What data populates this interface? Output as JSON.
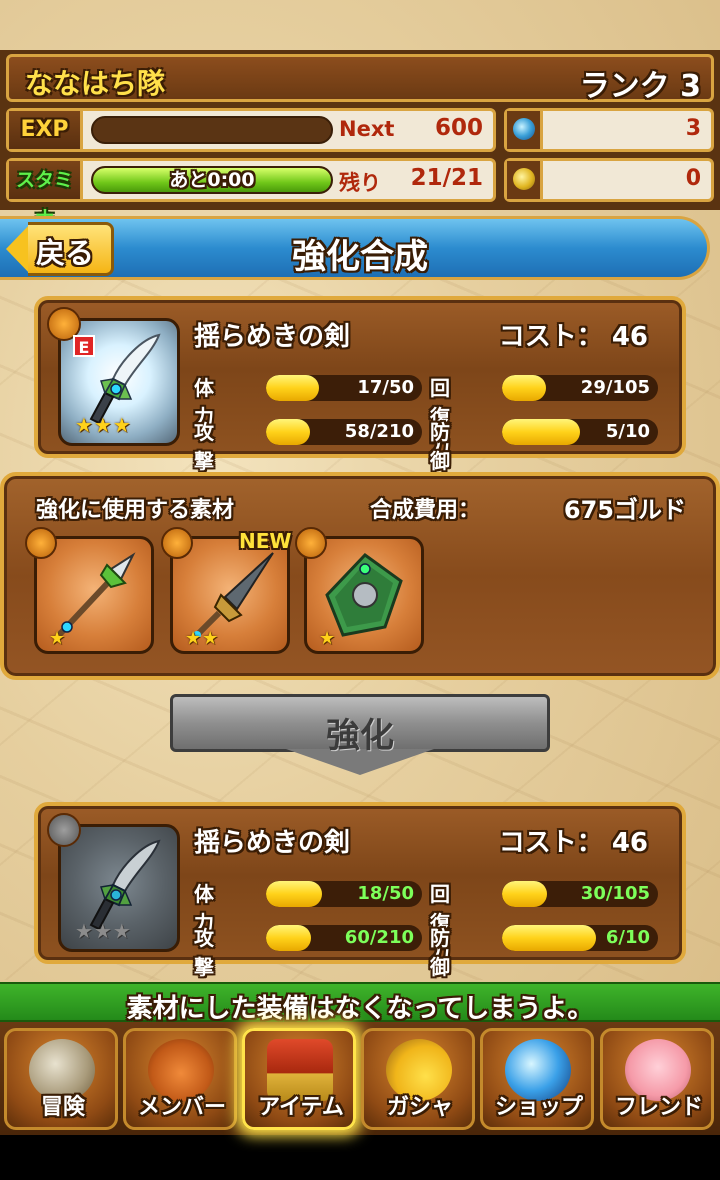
{
  "header": {
    "team_name": "ななはち隊",
    "rank": "ランク 3",
    "exp": {
      "label": "EXP",
      "next_label": "Next",
      "next_value": "600",
      "fill": 0.0
    },
    "stamina": {
      "label": "スタミナ",
      "timer": "あと0:00",
      "remain_label": "残り",
      "value": "21/21",
      "fill": 1.0
    },
    "gems": "3",
    "gold": "0"
  },
  "titlebar": {
    "back_label": "戻る",
    "title": "強化合成"
  },
  "before": {
    "name": "揺らめきの剣",
    "cost_label": "コスト：",
    "cost": "46",
    "rarity_badge": "E",
    "stars": "★★★",
    "stats": [
      {
        "label": "体　力",
        "value": "17/50",
        "fill": 0.34
      },
      {
        "label": "回復力",
        "value": "29/105",
        "fill": 0.28
      },
      {
        "label": "攻撃力",
        "value": "58/210",
        "fill": 0.28
      },
      {
        "label": "防御力",
        "value": "5/10",
        "fill": 0.5
      }
    ]
  },
  "materials": {
    "label": "強化に使用する素材",
    "fee_label": "合成費用：",
    "fee_value": "675ゴルド",
    "items": [
      {
        "icon": "spear-icon",
        "stars": "★",
        "new": ""
      },
      {
        "icon": "drill-lance-icon",
        "stars": "★★",
        "new": "NEW"
      },
      {
        "icon": "shield-icon",
        "stars": "★",
        "new": ""
      }
    ]
  },
  "enhance_button": {
    "label": "強化"
  },
  "after": {
    "name": "揺らめきの剣",
    "cost_label": "コスト：",
    "cost": "46",
    "stars": "★★★",
    "stats": [
      {
        "label": "体　力",
        "value": "18/50",
        "fill": 0.36
      },
      {
        "label": "回復力",
        "value": "30/105",
        "fill": 0.29
      },
      {
        "label": "攻撃力",
        "value": "60/210",
        "fill": 0.29
      },
      {
        "label": "防御力",
        "value": "6/10",
        "fill": 0.6
      }
    ]
  },
  "warning": "素材にした装備はなくなってしまうよ。",
  "nav": [
    {
      "label": "冒険",
      "icon": "adventure-icon"
    },
    {
      "label": "メンバー",
      "icon": "paw-icon"
    },
    {
      "label": "アイテム",
      "icon": "treasure-chest-icon",
      "active": true
    },
    {
      "label": "ガシャ",
      "icon": "gacha-icon"
    },
    {
      "label": "ショップ",
      "icon": "crystal-orb-icon"
    },
    {
      "label": "フレンド",
      "icon": "friends-icon"
    }
  ],
  "colors": {
    "accent_gold": "#e0a93c",
    "title_blue": "#2c8ccf",
    "warning_green": "#3fb42a",
    "stat_red": "#b0280c"
  }
}
